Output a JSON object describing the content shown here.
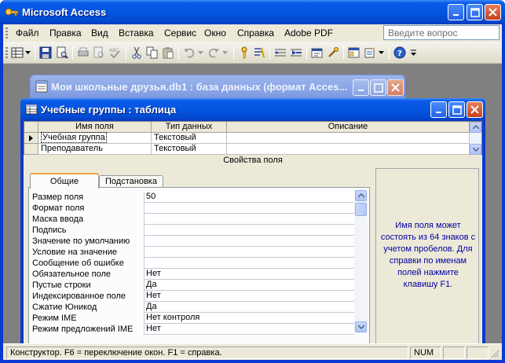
{
  "app": {
    "title": "Microsoft Access",
    "menu": [
      "Файл",
      "Правка",
      "Вид",
      "Вставка",
      "Сервис",
      "Окно",
      "Справка",
      "Adobe PDF"
    ],
    "help_placeholder": "Введите вопрос"
  },
  "db_window": {
    "title": "Мои школьные друзья.db1 : база данных (формат Acces..."
  },
  "table_window": {
    "title": "Учебные группы : таблица",
    "columns": [
      "Имя поля",
      "Тип данных",
      "Описание"
    ],
    "rows": [
      {
        "field": "Учебная группа",
        "type": "Текстовый",
        "description": ""
      },
      {
        "field": "Преподаватель",
        "type": "Текстовый",
        "description": ""
      }
    ],
    "props_header": "Свойства поля",
    "tabs": [
      "Общие",
      "Подстановка"
    ],
    "properties": [
      {
        "label": "Размер поля",
        "value": "50"
      },
      {
        "label": "Формат поля",
        "value": ""
      },
      {
        "label": "Маска ввода",
        "value": ""
      },
      {
        "label": "Подпись",
        "value": ""
      },
      {
        "label": "Значение по умолчанию",
        "value": ""
      },
      {
        "label": "Условие на значение",
        "value": ""
      },
      {
        "label": "Сообщение об ошибке",
        "value": ""
      },
      {
        "label": "Обязательное поле",
        "value": "Нет"
      },
      {
        "label": "Пустые строки",
        "value": "Да"
      },
      {
        "label": "Индексированное поле",
        "value": "Нет"
      },
      {
        "label": "Сжатие Юникод",
        "value": "Да"
      },
      {
        "label": "Режим IME",
        "value": "Нет контроля"
      },
      {
        "label": "Режим предложений IME",
        "value": "Нет"
      }
    ],
    "hint": "Имя поля может состоять из 64 знаков с учетом пробелов. Для справки по именам полей нажмите клавишу F1."
  },
  "status": {
    "text": "Конструктор.  F6 = переключение окон.  F1 = справка.",
    "num": "NUM"
  },
  "colors": {
    "titlebar": "#0455e0",
    "hint_text": "#0000a0",
    "face": "#ece9d8"
  }
}
